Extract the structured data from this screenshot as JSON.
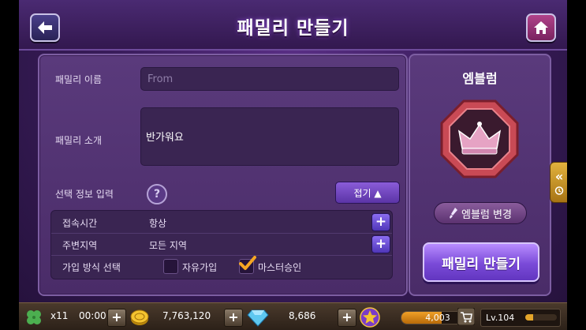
{
  "header": {
    "title": "패밀리 만들기",
    "back_icon": "back-arrow-icon",
    "home_icon": "home-icon"
  },
  "form": {
    "name_label": "패밀리 이름",
    "name_value": "From",
    "intro_label": "패밀리 소개",
    "intro_value": "반가워요",
    "optional_label": "선택 정보 입력",
    "help_glyph": "?",
    "fold_label": "접기 ▲",
    "options": [
      {
        "label": "접속시간",
        "value": "항상"
      },
      {
        "label": "주변지역",
        "value": "모든 지역"
      }
    ],
    "join_method_label": "가입 방식 선택",
    "join_free_label": "자유가입",
    "join_master_label": "마스터승인",
    "join_selected": "master"
  },
  "emblem": {
    "title": "엠블럼",
    "change_label": "엠블럼 변경",
    "create_label": "패밀리 만들기",
    "frame_color": "#c94a55",
    "crown_color": "#e6a3c4"
  },
  "side_tab": {
    "glyph": "«"
  },
  "status_bar": {
    "clover_count": "x11",
    "timer": "00:00",
    "gold": "7,763,120",
    "diamonds": "8,686",
    "exp": "4,003",
    "exp_fraction": 0.55,
    "level": "Lv.104",
    "level_fraction": 0.25,
    "plus_glyph": "+"
  },
  "colors": {
    "accent": "#7a4ad8",
    "panel": "#4a2c68"
  }
}
